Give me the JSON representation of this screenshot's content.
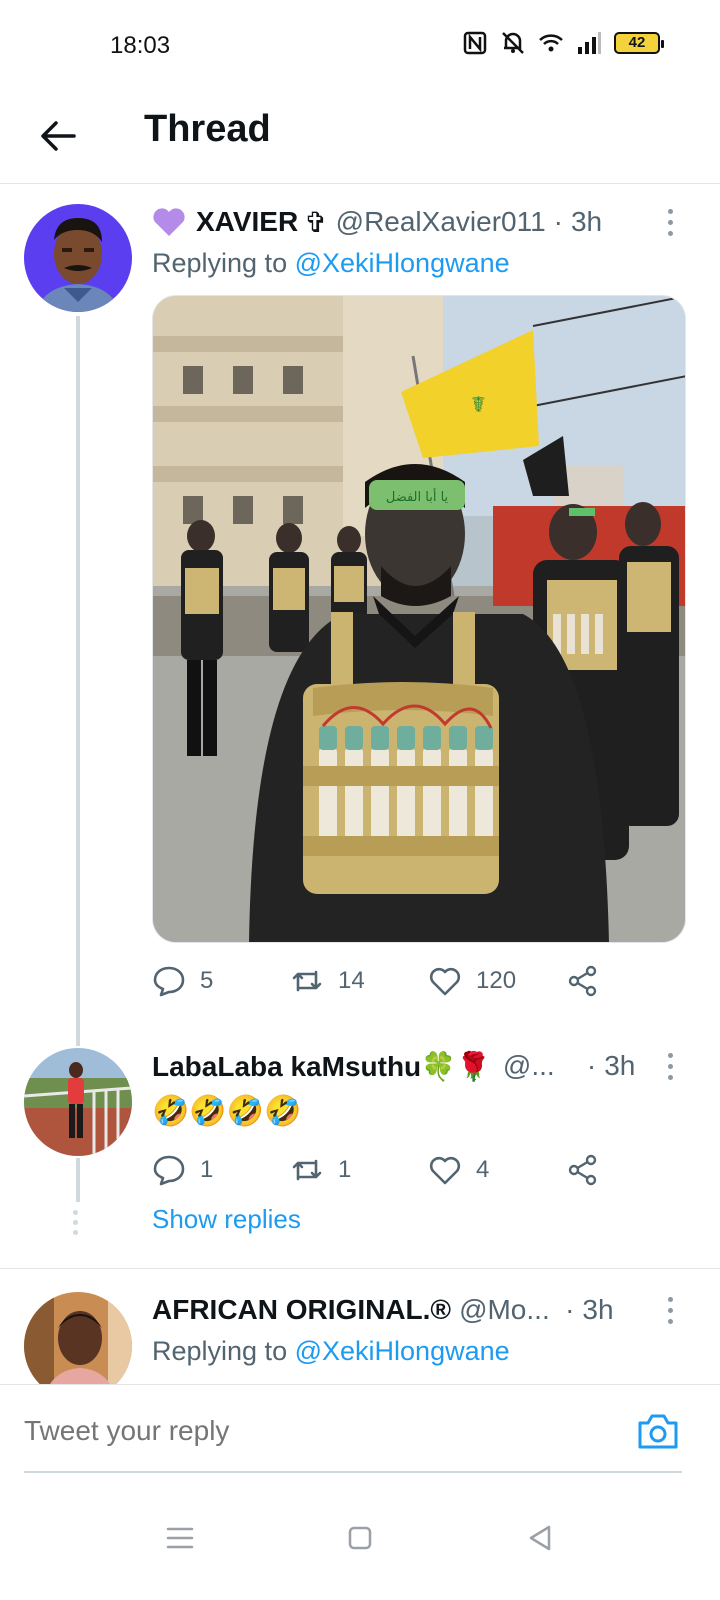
{
  "status_bar": {
    "time": "18:03",
    "battery": "42"
  },
  "header": {
    "title": "Thread"
  },
  "tweets": [
    {
      "name": "XAVIER",
      "name_suffix": "✞",
      "handle": "@RealXavier011",
      "dot": "·",
      "time": "3h",
      "reply_prefix": "Replying to",
      "reply_to": "@XekiHlongwane",
      "has_media": true,
      "flag_text": "يا أبا الفضل",
      "stats": {
        "replies": "5",
        "retweets": "14",
        "likes": "120"
      }
    },
    {
      "name": "LabaLaba kaMsuthu🍀🌹",
      "handle": "@...",
      "dot": "·",
      "time": "3h",
      "text": "🤣🤣🤣🤣",
      "stats": {
        "replies": "1",
        "retweets": "1",
        "likes": "4"
      },
      "show_replies": "Show replies"
    },
    {
      "name": "AFRICAN ORIGINAL.®",
      "handle": "@Mo...",
      "dot": "·",
      "time": "3h",
      "reply_prefix": "Replying to",
      "reply_to": "@XekiHlongwane"
    }
  ],
  "composer": {
    "placeholder": "Tweet your reply"
  },
  "colors": {
    "accent": "#1d9bf0",
    "text": "#0f1419",
    "muted": "#536471",
    "divider": "#e3e6e8"
  },
  "icons": [
    "back-arrow-icon",
    "more-icon",
    "reply-icon",
    "retweet-icon",
    "like-icon",
    "share-icon",
    "camera-icon",
    "menu-icon",
    "home-icon",
    "back-nav-icon"
  ]
}
